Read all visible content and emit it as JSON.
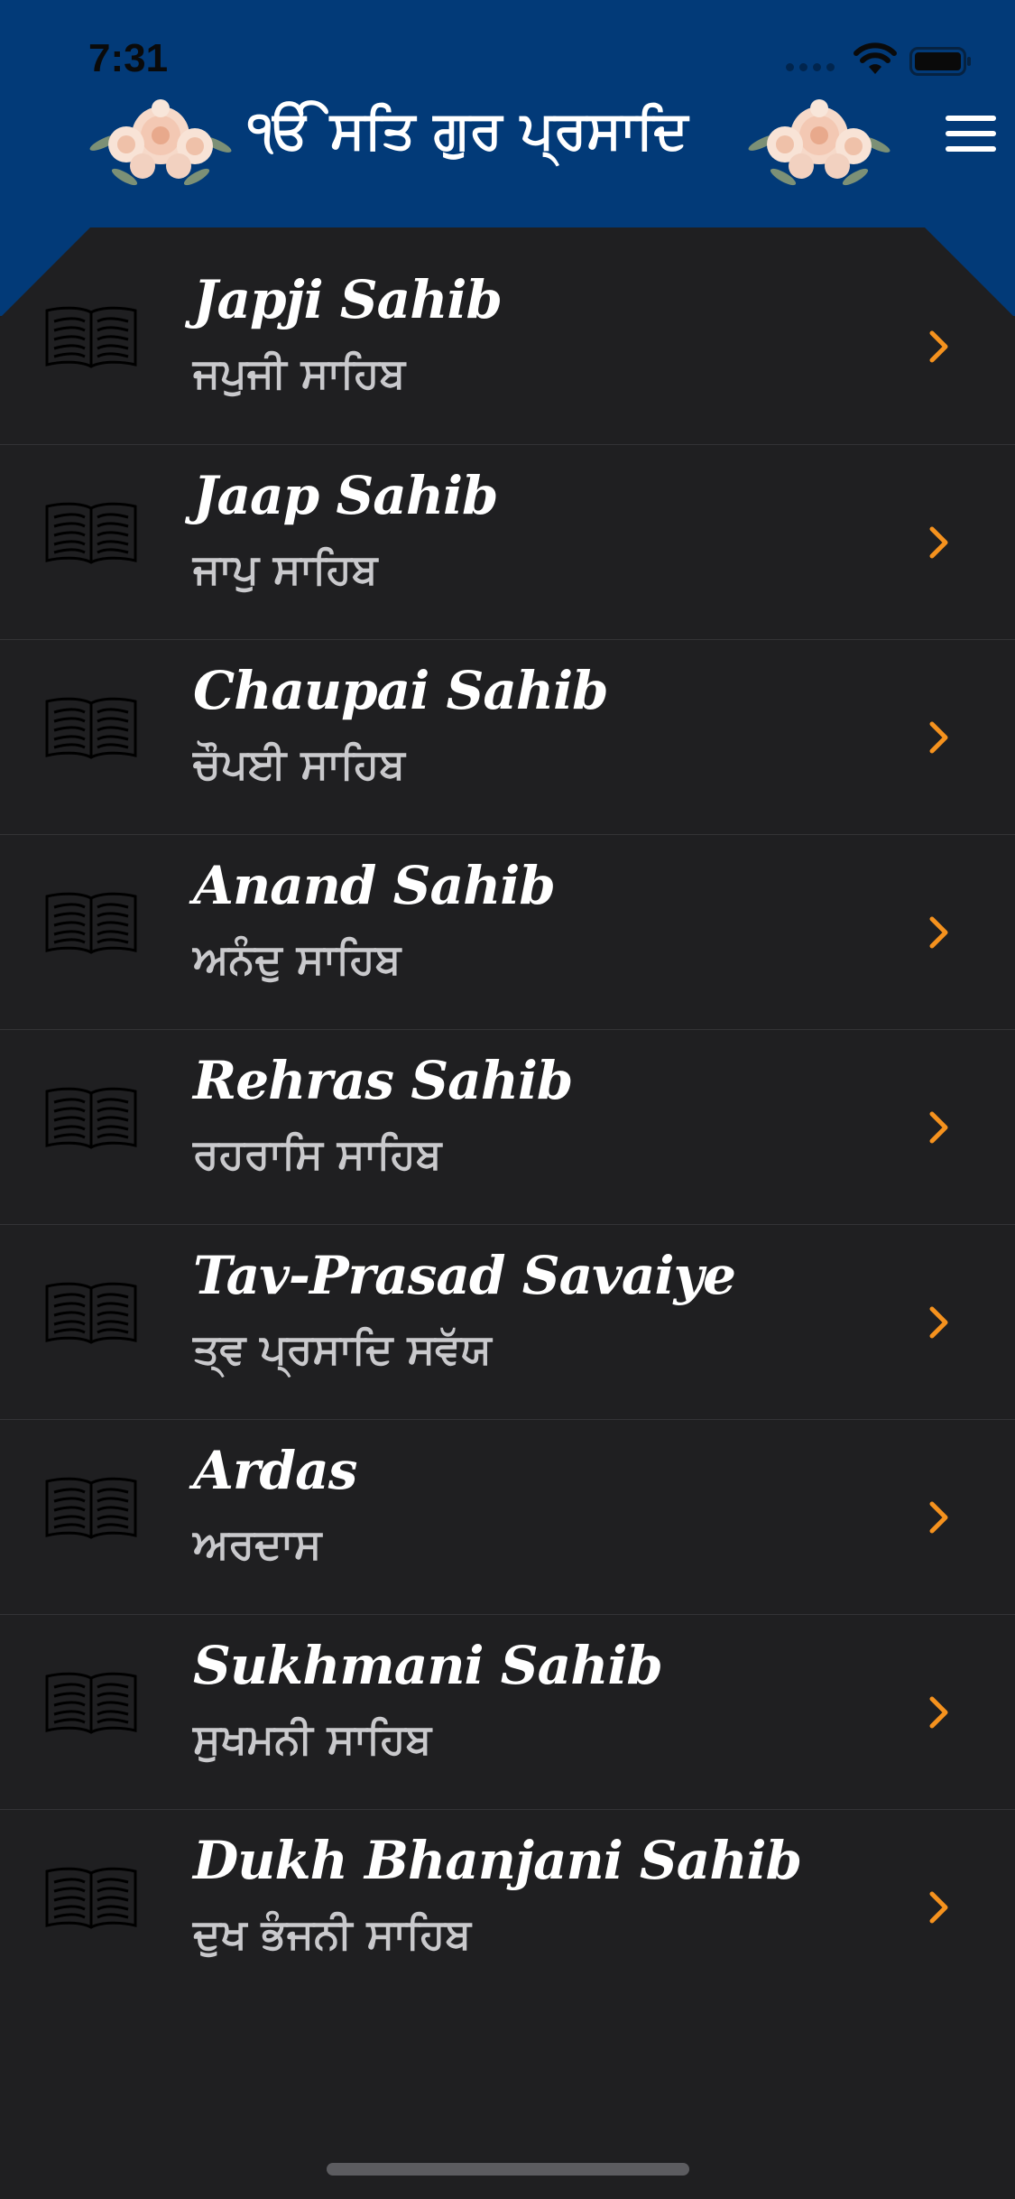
{
  "status_bar": {
    "time": "7:31"
  },
  "header": {
    "title": "ੴ ਸਤਿ ਗੁਰ ਪ੍ਰਸਾਦਿ",
    "background_color": "#023a78",
    "left_decoration": "flower-bouquet",
    "right_decoration": "flower-bouquet",
    "menu_icon": "hamburger-menu-icon"
  },
  "list": {
    "items": [
      {
        "title_en": "Japji Sahib",
        "title_pa": "ਜਪੁਜੀ ਸਾਹਿਬ",
        "icon": "book-icon"
      },
      {
        "title_en": "Jaap Sahib",
        "title_pa": "ਜਾਪੁ ਸਾਹਿਬ",
        "icon": "book-icon"
      },
      {
        "title_en": "Chaupai Sahib",
        "title_pa": "ਚੌਪਈ ਸਾਹਿਬ",
        "icon": "book-icon"
      },
      {
        "title_en": "Anand Sahib",
        "title_pa": "ਅਨੰਦੁ ਸਾਹਿਬ",
        "icon": "book-icon"
      },
      {
        "title_en": "Rehras Sahib",
        "title_pa": "ਰਹਰਾਸਿ ਸਾਹਿਬ",
        "icon": "book-icon"
      },
      {
        "title_en": "Tav-Prasad Savaiye",
        "title_pa": "ਤ੍ਵ ਪ੍ਰਸਾਦਿ ਸਵੱਯ",
        "icon": "book-icon"
      },
      {
        "title_en": "Ardas",
        "title_pa": "ਅਰਦਾਸ",
        "icon": "book-icon"
      },
      {
        "title_en": "Sukhmani Sahib",
        "title_pa": "ਸੁਖਮਨੀ ਸਾਹਿਬ",
        "icon": "book-icon"
      },
      {
        "title_en": "Dukh Bhanjani Sahib",
        "title_pa": "ਦੁਖ ਭੰਜਨੀ ਸਾਹਿਬ",
        "icon": "book-icon"
      }
    ],
    "chevron_icon": "chevron-right-icon",
    "chevron_color": "#f5921e",
    "background_color": "#1f1f21"
  }
}
